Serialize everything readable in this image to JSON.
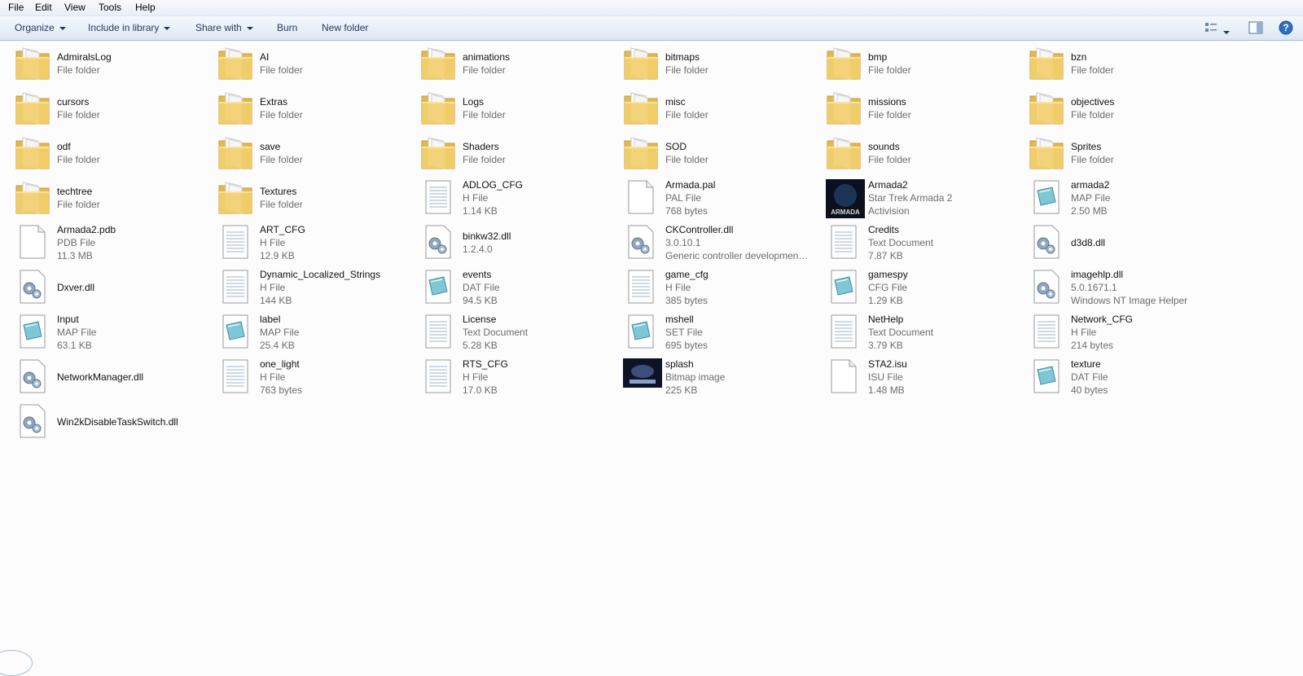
{
  "menu": [
    "File",
    "Edit",
    "View",
    "Tools",
    "Help"
  ],
  "toolbar": {
    "organize": "Organize",
    "include": "Include in library",
    "share": "Share with",
    "burn": "Burn",
    "new_folder": "New folder"
  },
  "items": [
    {
      "name": "AdmiralsLog",
      "details": [
        "File folder"
      ],
      "icon": "folder-icon"
    },
    {
      "name": "AI",
      "details": [
        "File folder"
      ],
      "icon": "folder-icon"
    },
    {
      "name": "animations",
      "details": [
        "File folder"
      ],
      "icon": "folder-icon"
    },
    {
      "name": "bitmaps",
      "details": [
        "File folder"
      ],
      "icon": "folder-icon"
    },
    {
      "name": "bmp",
      "details": [
        "File folder"
      ],
      "icon": "folder-icon"
    },
    {
      "name": "bzn",
      "details": [
        "File folder"
      ],
      "icon": "folder-icon"
    },
    {
      "name": "cursors",
      "details": [
        "File folder"
      ],
      "icon": "folder-icon"
    },
    {
      "name": "Extras",
      "details": [
        "File folder"
      ],
      "icon": "folder-icon"
    },
    {
      "name": "Logs",
      "details": [
        "File folder"
      ],
      "icon": "folder-icon"
    },
    {
      "name": "misc",
      "details": [
        "File folder"
      ],
      "icon": "folder-icon"
    },
    {
      "name": "missions",
      "details": [
        "File folder"
      ],
      "icon": "folder-icon"
    },
    {
      "name": "objectives",
      "details": [
        "File folder"
      ],
      "icon": "folder-icon"
    },
    {
      "name": "odf",
      "details": [
        "File folder"
      ],
      "icon": "folder-icon"
    },
    {
      "name": "save",
      "details": [
        "File folder"
      ],
      "icon": "folder-icon"
    },
    {
      "name": "Shaders",
      "details": [
        "File folder"
      ],
      "icon": "folder-icon"
    },
    {
      "name": "SOD",
      "details": [
        "File folder"
      ],
      "icon": "folder-icon"
    },
    {
      "name": "sounds",
      "details": [
        "File folder"
      ],
      "icon": "folder-icon"
    },
    {
      "name": "Sprites",
      "details": [
        "File folder"
      ],
      "icon": "folder-icon"
    },
    {
      "name": "techtree",
      "details": [
        "File folder"
      ],
      "icon": "folder-icon"
    },
    {
      "name": "Textures",
      "details": [
        "File folder"
      ],
      "icon": "folder-icon"
    },
    {
      "name": "ADLOG_CFG",
      "details": [
        "H File",
        "1.14 KB"
      ],
      "icon": "text-file-icon"
    },
    {
      "name": "Armada.pal",
      "details": [
        "PAL File",
        "768 bytes"
      ],
      "icon": "blank-file-icon"
    },
    {
      "name": "Armada2",
      "details": [
        "Star Trek Armada 2",
        "Activision"
      ],
      "icon": "armada-app-icon"
    },
    {
      "name": "armada2",
      "details": [
        "MAP File",
        "2.50 MB"
      ],
      "icon": "map-file-icon"
    },
    {
      "name": "Armada2.pdb",
      "details": [
        "PDB File",
        "11.3 MB"
      ],
      "icon": "blank-file-icon"
    },
    {
      "name": "ART_CFG",
      "details": [
        "H File",
        "12.9 KB"
      ],
      "icon": "text-file-icon"
    },
    {
      "name": "binkw32.dll",
      "details": [
        "1.2.4.0"
      ],
      "icon": "dll-icon"
    },
    {
      "name": "CKController.dll",
      "details": [
        "3.0.10.1",
        "Generic controller development li..."
      ],
      "icon": "dll-icon"
    },
    {
      "name": "Credits",
      "details": [
        "Text Document",
        "7.87 KB"
      ],
      "icon": "text-file-icon"
    },
    {
      "name": "d3d8.dll",
      "details": [],
      "icon": "dll-icon"
    },
    {
      "name": "Dxver.dll",
      "details": [],
      "icon": "dll-icon"
    },
    {
      "name": "Dynamic_Localized_Strings",
      "details": [
        "H File",
        "144 KB"
      ],
      "icon": "text-file-icon"
    },
    {
      "name": "events",
      "details": [
        "DAT File",
        "94.5 KB"
      ],
      "icon": "map-file-icon"
    },
    {
      "name": "game_cfg",
      "details": [
        "H File",
        "385 bytes"
      ],
      "icon": "text-file-icon"
    },
    {
      "name": "gamespy",
      "details": [
        "CFG File",
        "1.29 KB"
      ],
      "icon": "map-file-icon"
    },
    {
      "name": "imagehlp.dll",
      "details": [
        "5.0.1671.1",
        "Windows NT Image Helper"
      ],
      "icon": "dll-icon"
    },
    {
      "name": "Input",
      "details": [
        "MAP File",
        "63.1 KB"
      ],
      "icon": "map-file-icon"
    },
    {
      "name": "label",
      "details": [
        "MAP File",
        "25.4 KB"
      ],
      "icon": "map-file-icon"
    },
    {
      "name": "License",
      "details": [
        "Text Document",
        "5.28 KB"
      ],
      "icon": "text-file-icon"
    },
    {
      "name": "mshell",
      "details": [
        "SET File",
        "695 bytes"
      ],
      "icon": "map-file-icon"
    },
    {
      "name": "NetHelp",
      "details": [
        "Text Document",
        "3.79 KB"
      ],
      "icon": "text-file-icon"
    },
    {
      "name": "Network_CFG",
      "details": [
        "H File",
        "214 bytes"
      ],
      "icon": "text-file-icon"
    },
    {
      "name": "NetworkManager.dll",
      "details": [],
      "icon": "dll-icon"
    },
    {
      "name": "one_light",
      "details": [
        "H File",
        "763 bytes"
      ],
      "icon": "text-file-icon"
    },
    {
      "name": "RTS_CFG",
      "details": [
        "H File",
        "17.0 KB"
      ],
      "icon": "text-file-icon"
    },
    {
      "name": "splash",
      "details": [
        "Bitmap image",
        "225 KB"
      ],
      "icon": "splash-image-icon"
    },
    {
      "name": "STA2.isu",
      "details": [
        "ISU File",
        "1.48 MB"
      ],
      "icon": "blank-file-icon"
    },
    {
      "name": "texture",
      "details": [
        "DAT File",
        "40 bytes"
      ],
      "icon": "map-file-icon"
    },
    {
      "name": "Win2kDisableTaskSwitch.dll",
      "details": [],
      "icon": "dll-icon"
    }
  ]
}
